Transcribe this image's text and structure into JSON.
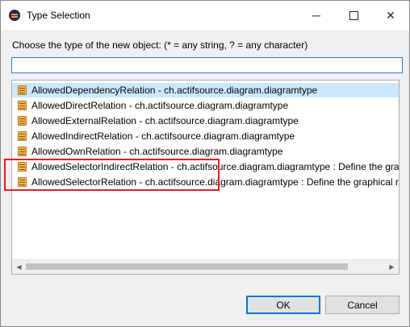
{
  "window": {
    "title": "Type Selection",
    "controls": {
      "minimize": "─",
      "close": "✕"
    }
  },
  "prompt": "Choose the type of the new object: (* = any string, ? = any character)",
  "filter": {
    "value": "",
    "placeholder": ""
  },
  "list": {
    "items": [
      {
        "label": "AllowedDependencyRelation - ch.actifsource.diagram.diagramtype",
        "icon": "class-icon",
        "selected": true
      },
      {
        "label": "AllowedDirectRelation - ch.actifsource.diagram.diagramtype",
        "icon": "class-icon",
        "selected": false
      },
      {
        "label": "AllowedExternalRelation - ch.actifsource.diagram.diagramtype",
        "icon": "class-icon",
        "selected": false
      },
      {
        "label": "AllowedIndirectRelation - ch.actifsource.diagram.diagramtype",
        "icon": "class-icon",
        "selected": false
      },
      {
        "label": "AllowedOwnRelation - ch.actifsource.diagram.diagramtype",
        "icon": "class-icon",
        "selected": false
      },
      {
        "label": "AllowedSelectorIndirectRelation - ch.actifsource.diagram.diagramtype : Define the graphical representation",
        "icon": "class-icon",
        "selected": false
      },
      {
        "label": "AllowedSelectorRelation - ch.actifsource.diagram.diagramtype : Define the graphical representation",
        "icon": "class-icon",
        "selected": false
      }
    ],
    "scroll_arrows": {
      "left": "◀",
      "right": "▶"
    }
  },
  "buttons": {
    "ok": "OK",
    "cancel": "Cancel"
  },
  "colors": {
    "selection": "#cce8ff",
    "highlight": "#e01e25",
    "focus": "#0078d7"
  }
}
